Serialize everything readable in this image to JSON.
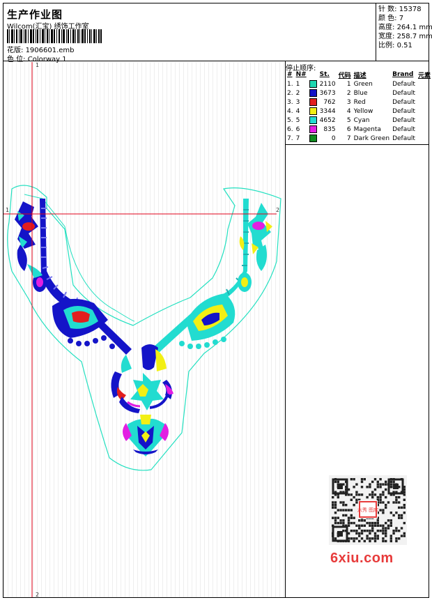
{
  "header": {
    "title": "生产作业图",
    "company": "Wilcom(汇宝) 绣饰工作室",
    "design_label": "花版:",
    "design_file": "1906601.emb",
    "colorway_label": "色 位:",
    "colorway": "Colorway 1"
  },
  "stats": [
    {
      "label": "针 数:",
      "value": "15378"
    },
    {
      "label": "颜 色:",
      "value": "7"
    },
    {
      "label": "高度:",
      "value": "264.1 mm"
    },
    {
      "label": "宽度:",
      "value": "258.7 mm"
    },
    {
      "label": "比例:",
      "value": "0.51"
    }
  ],
  "stop_sequence": {
    "title": "停止顺序:",
    "headers": [
      "#",
      "N#",
      "St.",
      "代码",
      "描述",
      "Brand",
      "元素"
    ],
    "rows": [
      {
        "idx": "1.",
        "n": "1",
        "color": "#1fd7b0",
        "st": "2110",
        "code": "1",
        "desc": "Green",
        "brand": "Default"
      },
      {
        "idx": "2.",
        "n": "2",
        "color": "#1414c8",
        "st": "3673",
        "code": "2",
        "desc": "Blue",
        "brand": "Default"
      },
      {
        "idx": "3.",
        "n": "3",
        "color": "#e21e1e",
        "st": "762",
        "code": "3",
        "desc": "Red",
        "brand": "Default"
      },
      {
        "idx": "4.",
        "n": "4",
        "color": "#f2ef14",
        "st": "3344",
        "code": "4",
        "desc": "Yellow",
        "brand": "Default"
      },
      {
        "idx": "5.",
        "n": "5",
        "color": "#22dcd0",
        "st": "4652",
        "code": "5",
        "desc": "Cyan",
        "brand": "Default"
      },
      {
        "idx": "6.",
        "n": "6",
        "color": "#e21ee2",
        "st": "835",
        "code": "6",
        "desc": "Magenta",
        "brand": "Default"
      },
      {
        "idx": "7.",
        "n": "7",
        "color": "#0f8a1e",
        "st": "0",
        "code": "7",
        "desc": "Dark Green",
        "brand": "Default"
      }
    ]
  },
  "markers": {
    "v_top": "1",
    "v_bottom": "2",
    "h_left": "1",
    "h_right": "2"
  },
  "watermark": "6xiu.com",
  "qr_stamp": "六秀 图库",
  "colors": {
    "guide_line": "#e0001a",
    "outline": "#22e0c0"
  }
}
